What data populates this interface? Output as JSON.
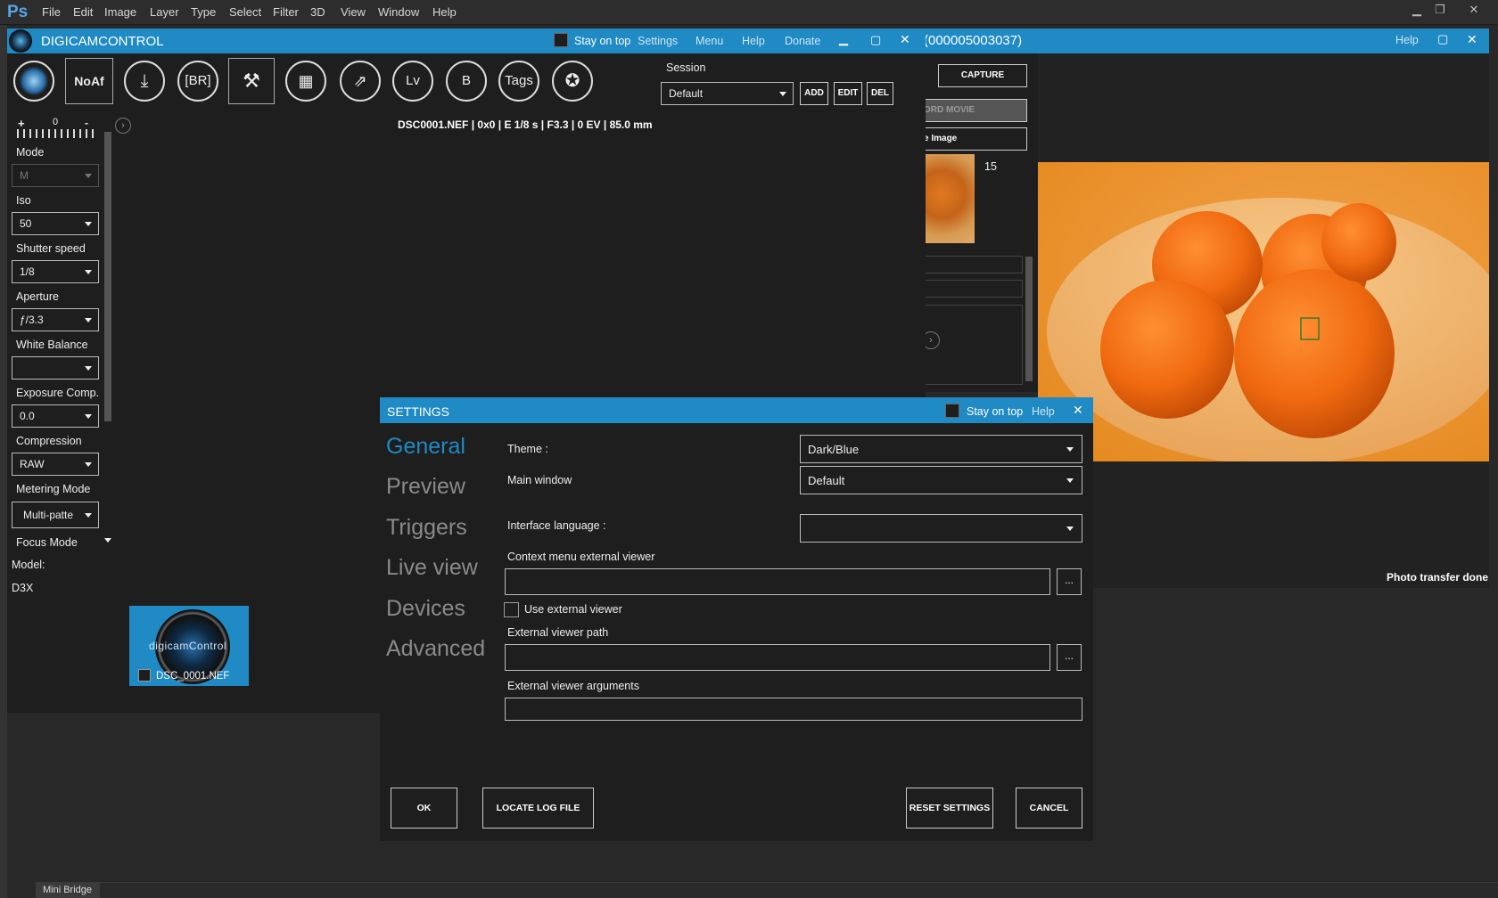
{
  "photoshop": {
    "logo": "Ps",
    "menu": [
      "File",
      "Edit",
      "Image",
      "Layer",
      "Type",
      "Select",
      "Filter",
      "3D",
      "View",
      "Window",
      "Help"
    ],
    "bottom_tab": "Mini Bridge"
  },
  "dcc": {
    "title": "DIGICAMCONTROL",
    "stay_on_top": "Stay on top",
    "links": [
      "Settings",
      "Menu",
      "Help",
      "Donate"
    ],
    "toolbar": [
      "[BR]",
      "Lv",
      "B",
      "Tags"
    ],
    "af_label": "NoAf",
    "session_label": "Session",
    "session_value": "Default",
    "session_buttons": [
      "ADD",
      "EDIT",
      "DEL"
    ],
    "photo_info": "DSC0001.NEF | 0x0 | E 1/8 s | F3.3 | 0 EV | 85.0 mm",
    "scale_labels": {
      "plus": "+",
      "zero": "0",
      "minus": "-"
    },
    "props": {
      "mode_label": "Mode",
      "mode_value": "M",
      "iso_label": "Iso",
      "iso_value": "50",
      "shutter_label": "Shutter speed",
      "shutter_value": "1/8",
      "aperture_label": "Aperture",
      "aperture_value": "ƒ/3.3",
      "wb_label": "White Balance",
      "wb_value": "",
      "exp_label": "Exposure Comp.",
      "exp_value": "0.0",
      "comp_label": "Compression",
      "comp_value": "RAW",
      "meter_label": "Metering Mode",
      "meter_value": "Multi-patte",
      "focus_label": "Focus Mode",
      "model_label": "Model:",
      "model_value": "D3X"
    },
    "thumb_caption": "DSC_0001.NEF",
    "thumb_logo": "digicamControl"
  },
  "camera_window": {
    "title": "(000005003037)",
    "help": "Help",
    "capture": "CAPTURE",
    "record": "ORD MOVIE",
    "image_btn": "e Image",
    "count": "15",
    "status": "Photo transfer done"
  },
  "settings": {
    "title": "SETTINGS",
    "stay_on_top": "Stay on top",
    "help": "Help",
    "nav": [
      "General",
      "Preview",
      "Triggers",
      "Live view",
      "Devices",
      "Advanced"
    ],
    "theme_label": "Theme :",
    "theme_value": "Dark/Blue",
    "main_window_label": "Main window",
    "main_window_value": "Default",
    "language_label": "Interface language :",
    "language_value": "",
    "context_label": "Context menu external viewer",
    "use_external": "Use external viewer",
    "ext_path_label": "External viewer path",
    "ext_args_label": "External viewer arguments",
    "browse": "...",
    "buttons": {
      "ok": "OK",
      "locate": "LOCATE LOG FILE",
      "reset": "RESET SETTINGS",
      "cancel": "CANCEL"
    }
  },
  "colors": {
    "accent": "#1f8ac4",
    "background": "#1e1e1e"
  }
}
